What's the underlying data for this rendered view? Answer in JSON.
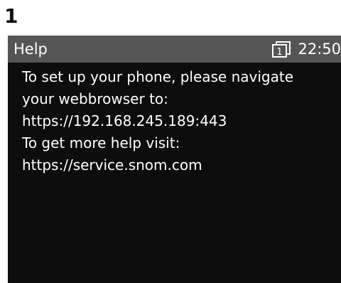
{
  "page_number": "1",
  "header": {
    "title": "Help",
    "line_indicator": "1",
    "time": "22:50",
    "icon": "active-line-icon"
  },
  "help": {
    "lines": [
      "To set up your phone, please navigate",
      "your webbrowser to:",
      "https://192.168.245.189:443",
      "To get more help visit:",
      "https://service.snom.com"
    ]
  },
  "colors": {
    "screen_background": "#0d0d0d",
    "titlebar_background": "#555555",
    "text": "#ffffff"
  }
}
